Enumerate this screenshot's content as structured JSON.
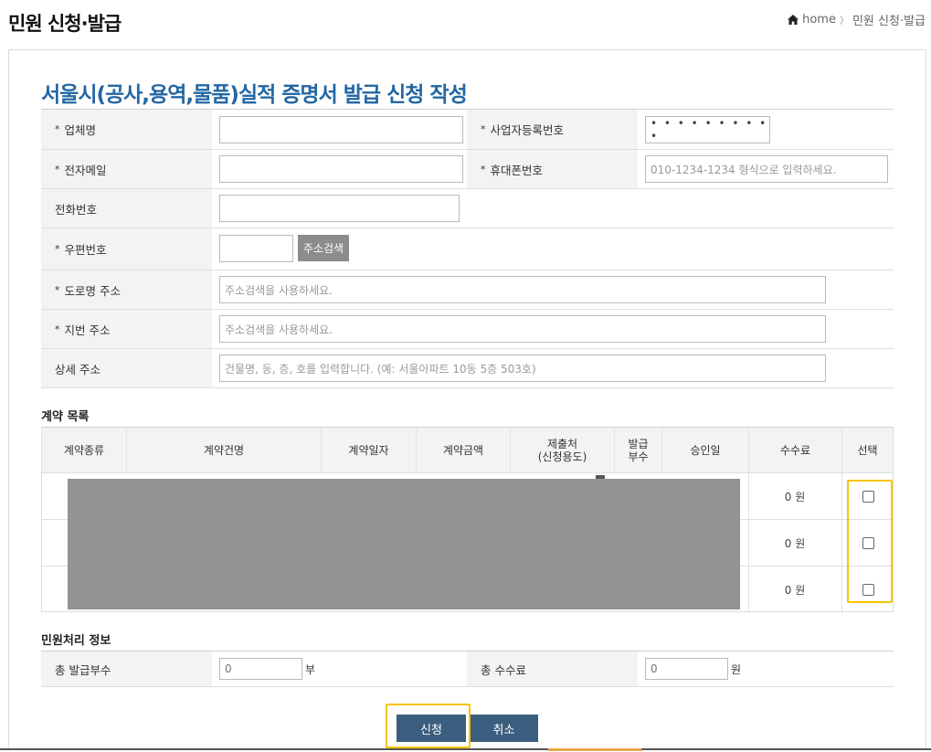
{
  "header": {
    "title": "민원 신청·발급",
    "breadcrumb_home": "home",
    "breadcrumb_sep": "〉",
    "breadcrumb_current": "민원 신청·발급"
  },
  "form": {
    "title": "서울시(공사,용역,물품)실적 증명서 발급 신청 작성",
    "required_mark": "*",
    "company_label": "업체명",
    "biz_no_label": "사업자등록번호",
    "biz_no_value": "• • • • • • • • • •",
    "email_label": "전자메일",
    "mobile_label": "휴대폰번호",
    "mobile_placeholder": "010-1234-1234 형식으로 입력하세요.",
    "phone_label": "전화번호",
    "postcode_label": "우편번호",
    "address_search_button": "주소검색",
    "road_address_label": "도로명 주소",
    "road_address_placeholder": "주소검색을 사용하세요.",
    "jibun_address_label": "지번 주소",
    "jibun_address_placeholder": "주소검색을 사용하세요.",
    "detail_address_label": "상세 주소",
    "detail_address_placeholder": "건물명, 동, 층, 호를 입력합니다. (예: 서울아파트 10동 5층 503호)"
  },
  "contracts": {
    "section_title": "계약 목록",
    "columns": [
      "계약종류",
      "계약건명",
      "계약일자",
      "계약금액",
      "제출처\n(신청용도)",
      "발급\n부수",
      "승인일",
      "수수료",
      "선택"
    ],
    "rows": [
      {
        "fee": "0 원"
      },
      {
        "fee": "0 원"
      },
      {
        "fee": "0 원"
      }
    ]
  },
  "processing": {
    "section_title": "민원처리 정보",
    "total_copies_label": "총 발급부수",
    "total_copies_value": "0",
    "total_copies_unit": "부",
    "total_fee_label": "총 수수료",
    "total_fee_value": "0",
    "total_fee_unit": "원"
  },
  "actions": {
    "submit_label": "신청",
    "cancel_label": "취소"
  },
  "colors": {
    "title_blue": "#2467a4",
    "button_blue": "#3b5e7e",
    "highlight": "#f5c400",
    "redaction": "#939393"
  }
}
